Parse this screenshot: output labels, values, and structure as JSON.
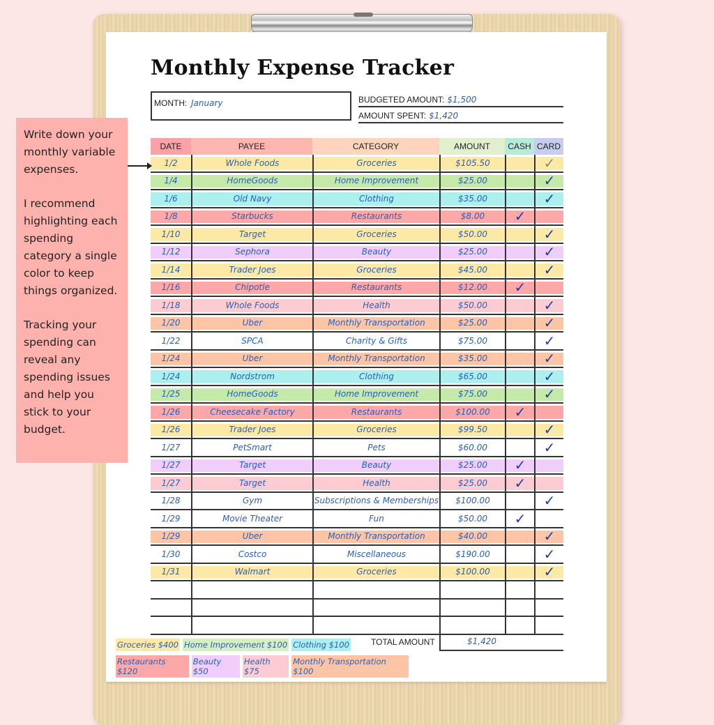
{
  "document": {
    "title": "Monthly Expense Tracker",
    "month_label": "MONTH:",
    "month_value": "January",
    "budgeted_label": "BUDGETED AMOUNT:",
    "budgeted_value": "$1,500",
    "spent_label": "AMOUNT SPENT:",
    "spent_value": "$1,420"
  },
  "table": {
    "headers": [
      {
        "label": "DATE",
        "color": "#f9a3a8"
      },
      {
        "label": "PAYEE",
        "color": "#fdb6b0"
      },
      {
        "label": "CATEGORY",
        "color": "#fdd5bd"
      },
      {
        "label": "AMOUNT",
        "color": "#e2efcf"
      },
      {
        "label": "CASH",
        "color": "#b7ead9"
      },
      {
        "label": "CARD",
        "color": "#c7cdee"
      }
    ],
    "rows": [
      {
        "date": "1/2",
        "payee": "Whole Foods",
        "category": "Groceries",
        "amount": "$105.50",
        "cash": false,
        "card": true,
        "card_gray": true,
        "color": "#fde9a6"
      },
      {
        "date": "1/4",
        "payee": "HomeGoods",
        "category": "Home Improvement",
        "amount": "$25.00",
        "cash": false,
        "card": true,
        "color": "#c4e9a8"
      },
      {
        "date": "1/6",
        "payee": "Old Navy",
        "category": "Clothing",
        "amount": "$35.00",
        "cash": false,
        "card": true,
        "color": "#adeeee"
      },
      {
        "date": "1/8",
        "payee": "Starbucks",
        "category": "Restaurants",
        "amount": "$8.00",
        "cash": true,
        "card": false,
        "color": "#fca8a8"
      },
      {
        "date": "1/10",
        "payee": "Target",
        "category": "Groceries",
        "amount": "$50.00",
        "cash": false,
        "card": true,
        "color": "#fde9a6"
      },
      {
        "date": "1/12",
        "payee": "Sephora",
        "category": "Beauty",
        "amount": "$25.00",
        "cash": false,
        "card": true,
        "color": "#f0cdfa"
      },
      {
        "date": "1/14",
        "payee": "Trader Joes",
        "category": "Groceries",
        "amount": "$45.00",
        "cash": false,
        "card": true,
        "color": "#fde9a6"
      },
      {
        "date": "1/16",
        "payee": "Chipotle",
        "category": "Restaurants",
        "amount": "$12.00",
        "cash": true,
        "card": false,
        "color": "#fca8a8"
      },
      {
        "date": "1/18",
        "payee": "Whole Foods",
        "category": "Health",
        "amount": "$50.00",
        "cash": false,
        "card": true,
        "color": "#fdccd2"
      },
      {
        "date": "1/20",
        "payee": "Uber",
        "category": "Monthly Transportation",
        "amount": "$25.00",
        "cash": false,
        "card": true,
        "color": "#fdc5a6"
      },
      {
        "date": "1/22",
        "payee": "SPCA",
        "category": "Charity & Gifts",
        "amount": "$75.00",
        "cash": false,
        "card": true,
        "color": "#ffffff"
      },
      {
        "date": "1/24",
        "payee": "Uber",
        "category": "Monthly Transportation",
        "amount": "$35.00",
        "cash": false,
        "card": true,
        "color": "#fdc5a6"
      },
      {
        "date": "1/24",
        "payee": "Nordstrom",
        "category": "Clothing",
        "amount": "$65.00",
        "cash": false,
        "card": true,
        "color": "#adeeee"
      },
      {
        "date": "1/25",
        "payee": "HomeGoods",
        "category": "Home Improvement",
        "amount": "$75.00",
        "cash": false,
        "card": true,
        "color": "#c4e9a8"
      },
      {
        "date": "1/26",
        "payee": "Cheesecake Factory",
        "category": "Restaurants",
        "amount": "$100.00",
        "cash": true,
        "card": false,
        "color": "#fca8a8"
      },
      {
        "date": "1/26",
        "payee": "Trader Joes",
        "category": "Groceries",
        "amount": "$99.50",
        "cash": false,
        "card": true,
        "color": "#fde9a6"
      },
      {
        "date": "1/27",
        "payee": "PetSmart",
        "category": "Pets",
        "amount": "$60.00",
        "cash": false,
        "card": true,
        "color": "#ffffff"
      },
      {
        "date": "1/27",
        "payee": "Target",
        "category": "Beauty",
        "amount": "$25.00",
        "cash": true,
        "card": false,
        "color": "#f0cdfa"
      },
      {
        "date": "1/27",
        "payee": "Target",
        "category": "Health",
        "amount": "$25.00",
        "cash": true,
        "card": false,
        "color": "#fdccd2"
      },
      {
        "date": "1/28",
        "payee": "Gym",
        "category": "Subscriptions & Memberships",
        "amount": "$100.00",
        "cash": false,
        "card": true,
        "color": "#ffffff"
      },
      {
        "date": "1/29",
        "payee": "Movie Theater",
        "category": "Fun",
        "amount": "$50.00",
        "cash": true,
        "card": false,
        "color": "#ffffff"
      },
      {
        "date": "1/29",
        "payee": "Uber",
        "category": "Monthly Transportation",
        "amount": "$40.00",
        "cash": false,
        "card": true,
        "color": "#fdc5a6"
      },
      {
        "date": "1/30",
        "payee": "Costco",
        "category": "Miscellaneous",
        "amount": "$190.00",
        "cash": false,
        "card": true,
        "color": "#ffffff"
      },
      {
        "date": "1/31",
        "payee": "Walmart",
        "category": "Groceries",
        "amount": "$100.00",
        "cash": false,
        "card": true,
        "color": "#fde9a6"
      },
      {
        "date": "",
        "payee": "",
        "category": "",
        "amount": "",
        "cash": false,
        "card": false,
        "color": "#ffffff"
      },
      {
        "date": "",
        "payee": "",
        "category": "",
        "amount": "",
        "cash": false,
        "card": false,
        "color": "#ffffff"
      },
      {
        "date": "",
        "payee": "",
        "category": "",
        "amount": "",
        "cash": false,
        "card": false,
        "color": "#ffffff"
      }
    ],
    "check_glyph": "✓",
    "total_label": "TOTAL AMOUNT",
    "total_value": "$1,420"
  },
  "legend": {
    "rows": [
      [
        {
          "label": "Groceries $400",
          "color": "#fde9a6"
        },
        {
          "label": "Home Improvement $100",
          "color": "#d6efc0"
        },
        {
          "label": "Clothing $100",
          "color": "#adeeee"
        }
      ],
      [
        {
          "label": "Restaurants $120",
          "color": "#fca8a8"
        },
        {
          "label": "Beauty $50",
          "color": "#f0cdfa"
        },
        {
          "label": "Health $75",
          "color": "#fdccd2"
        },
        {
          "label": "Monthly Transportation $100",
          "color": "#fdc5a6"
        }
      ]
    ]
  },
  "note": {
    "paragraphs": [
      "Write down your monthly variable expenses.",
      "I recommend highlighting each spending category a single color to keep things organized.",
      "Tracking your spending can reveal any spending issues and help you stick to your budget."
    ],
    "background": "#fdb2ae"
  }
}
